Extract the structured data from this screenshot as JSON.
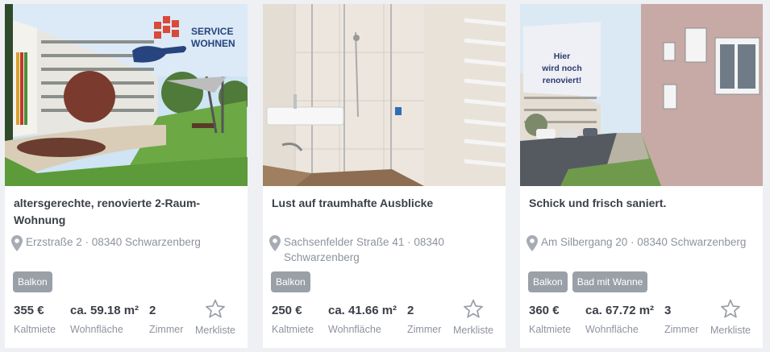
{
  "colors": {
    "tag_bg": "#9aa0a8",
    "text_dark": "#3b3f47",
    "text_muted": "#8d939d",
    "brand_red": "#d84a3a",
    "brand_blue": "#27447e"
  },
  "listings": [
    {
      "title": "altersgerechte, renovierte 2-Raum-Wohnung",
      "address": "Erzstraße 2 · 08340 Schwarzenberg",
      "tags": [
        "Balkon"
      ],
      "rent": "355 €",
      "rent_label": "Kaltmiete",
      "area": "ca. 59.18 m²",
      "area_label": "Wohnfläche",
      "rooms": "2",
      "rooms_label": "Zimmer",
      "bookmark_label": "Merkliste",
      "badge": {
        "line1": "SERVICE",
        "line2": "WOHNEN"
      }
    },
    {
      "title": "Lust auf traumhafte Ausblicke",
      "address": "Sachsenfelder Straße 41 · 08340 Schwarzenberg",
      "tags": [
        "Balkon"
      ],
      "rent": "250 €",
      "rent_label": "Kaltmiete",
      "area": "ca. 41.66 m²",
      "area_label": "Wohnfläche",
      "rooms": "2",
      "rooms_label": "Zimmer",
      "bookmark_label": "Merkliste"
    },
    {
      "title": "Schick und frisch saniert.",
      "address": "Am Silbergang 20 · 08340 Schwarzenberg",
      "tags": [
        "Balkon",
        "Bad mit Wanne"
      ],
      "rent": "360 €",
      "rent_label": "Kaltmiete",
      "area": "ca. 67.72 m²",
      "area_label": "Wohnfläche",
      "rooms": "3",
      "rooms_label": "Zimmer",
      "bookmark_label": "Merkliste",
      "sign": {
        "line1": "Hier",
        "line2": "wird noch",
        "line3": "renoviert!"
      }
    }
  ]
}
